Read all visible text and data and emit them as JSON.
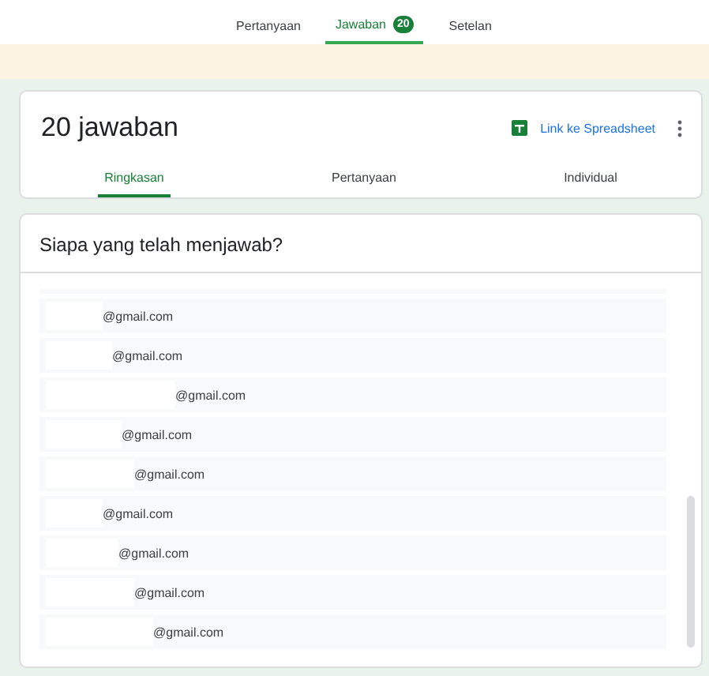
{
  "top_tabs": [
    {
      "label": "Pertanyaan",
      "selected": false
    },
    {
      "label": "Jawaban",
      "selected": true,
      "badge": "20"
    },
    {
      "label": "Setelan",
      "selected": false
    }
  ],
  "summary": {
    "title": "20 jawaban",
    "link": "Link ke Spreadsheet",
    "tabs": [
      {
        "label": "Ringkasan",
        "selected": true
      },
      {
        "label": "Pertanyaan",
        "selected": false
      },
      {
        "label": "Individual",
        "selected": false
      }
    ]
  },
  "respondents": {
    "title": "Siapa yang telah menjawab?",
    "emails": [
      "@gmail.com",
      "@gmail.com",
      "@gmail.com",
      "@gmail.com",
      "@gmail.com",
      "@gmail.com",
      "@gmail.com",
      "@gmail.com",
      "@gmail.com"
    ]
  }
}
